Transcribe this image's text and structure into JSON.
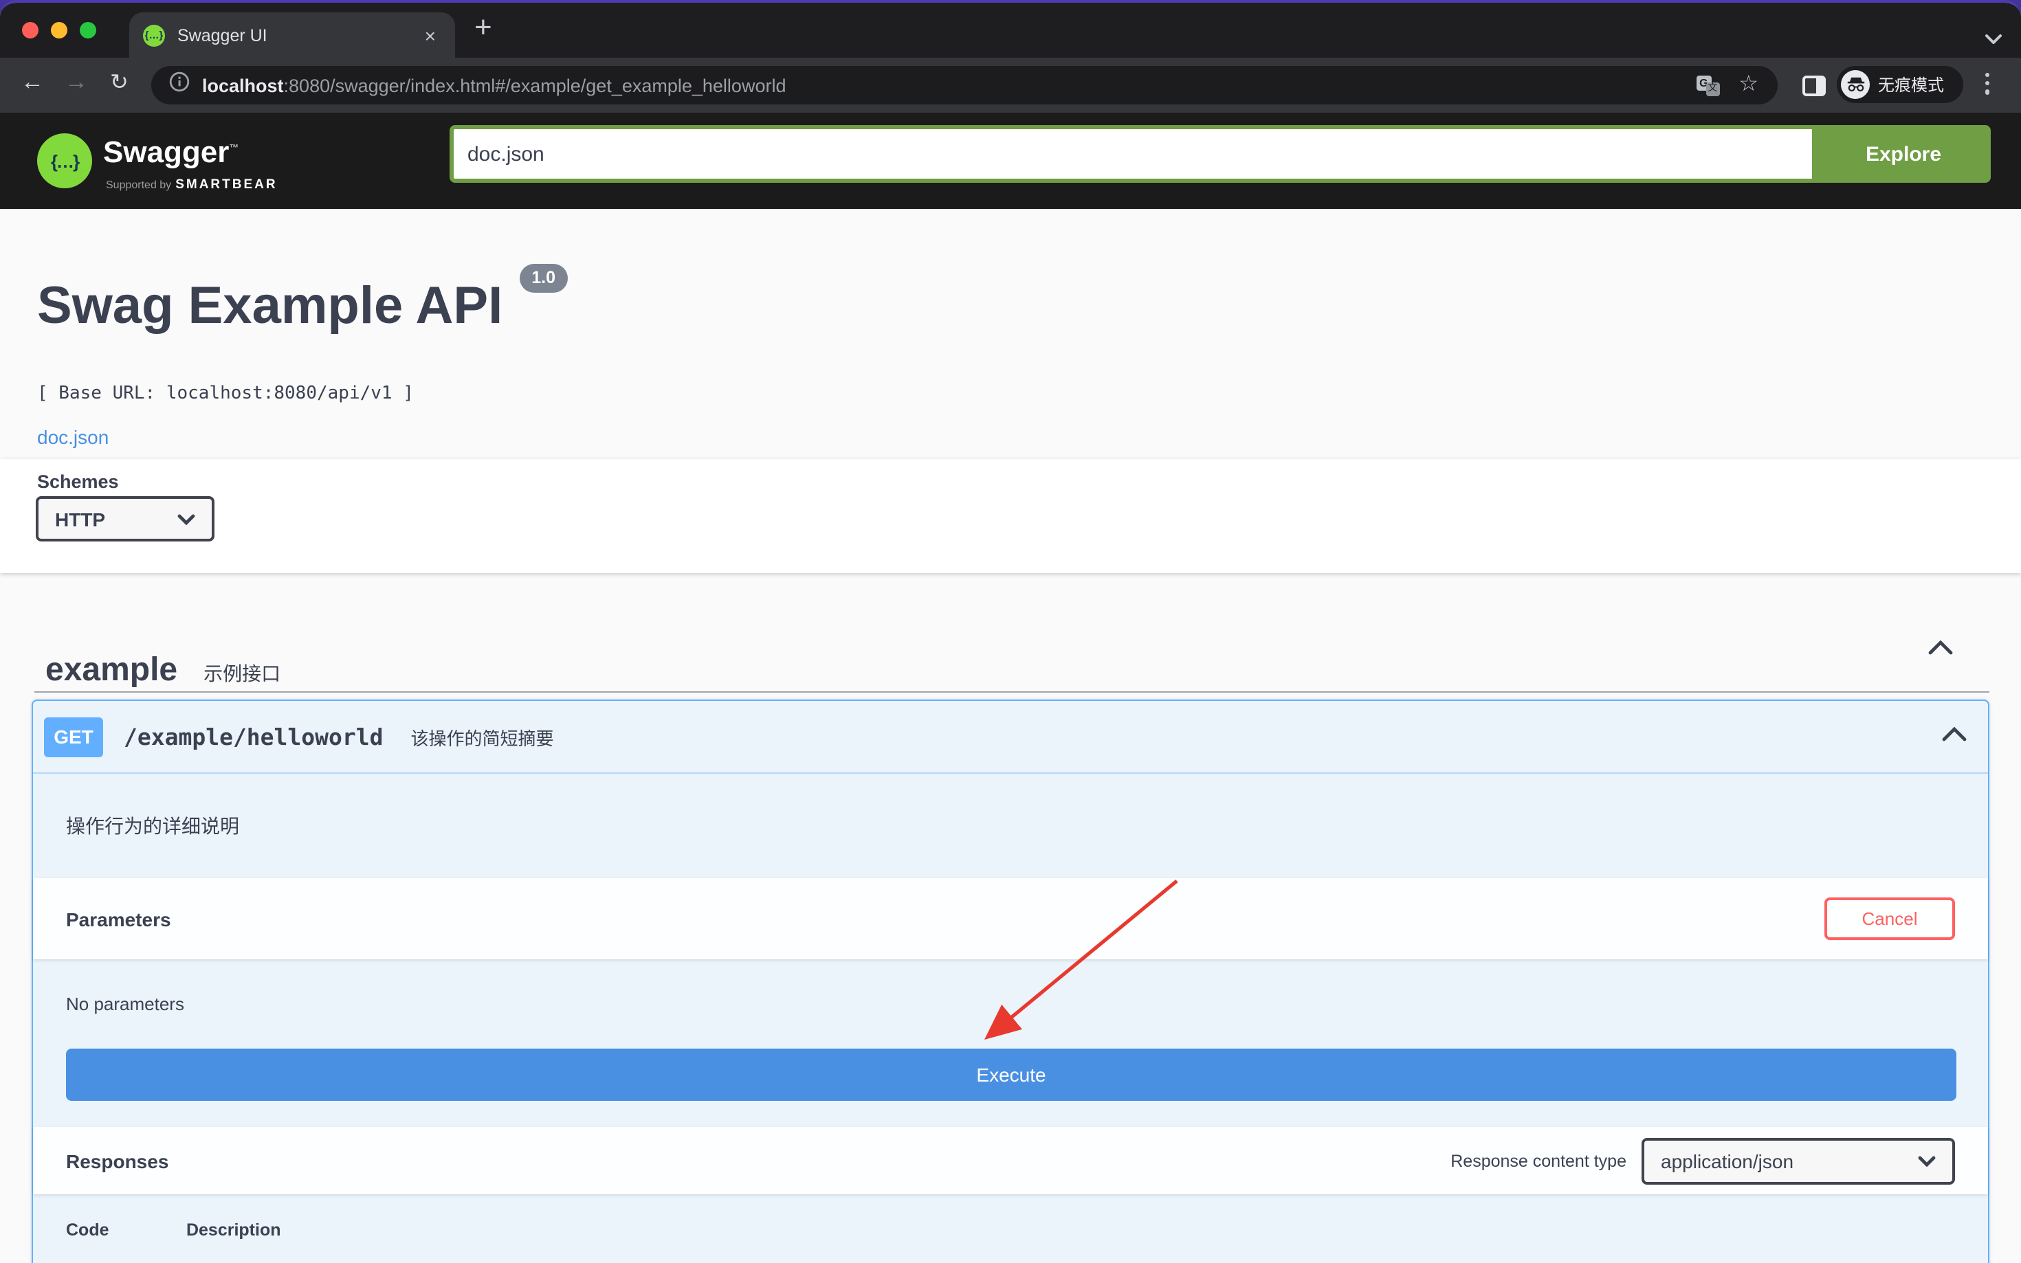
{
  "browser": {
    "tab_title": "Swagger UI",
    "close_glyph": "×",
    "new_tab_glyph": "+",
    "back_glyph": "←",
    "forward_glyph": "→",
    "reload_glyph": "↻",
    "star_glyph": "☆",
    "url_host": "localhost",
    "url_rest": ":8080/swagger/index.html#/example/get_example_helloworld",
    "incognito_label": "无痕模式",
    "translate_g": "G",
    "translate_zh": "文"
  },
  "topbar": {
    "logo_glyph": "{…}",
    "logo_text": "Swagger",
    "logo_tm": "™",
    "supported_by": "Supported by",
    "supported_brand": "SMARTBEAR",
    "search_value": "doc.json",
    "explore_label": "Explore"
  },
  "info": {
    "title": "Swag Example API",
    "version_badge": "1.0",
    "base_url": "[ Base URL: localhost:8080/api/v1 ]",
    "spec_link": "doc.json"
  },
  "schemes": {
    "label": "Schemes",
    "selected": "HTTP"
  },
  "tag": {
    "name": "example",
    "description": "示例接口"
  },
  "operation": {
    "method": "GET",
    "path": "/example/helloworld",
    "summary": "该操作的简短摘要",
    "description": "操作行为的详细说明",
    "parameters_title": "Parameters",
    "cancel_label": "Cancel",
    "no_parameters": "No parameters",
    "execute_label": "Execute",
    "responses_title": "Responses",
    "content_type_label": "Response content type",
    "content_type_value": "application/json",
    "col_code": "Code",
    "col_description": "Description"
  },
  "annotation": {
    "color": "#e8392e"
  },
  "colors": {
    "swagger_green": "#6f9e44",
    "logo_green": "#82d93c",
    "get_blue": "#61affe",
    "execute_blue": "#4990e2",
    "cancel_red": "#ff6060",
    "link_blue": "#4990e2",
    "version_badge_gray": "#7d8492",
    "opblock_bg": "#ebf3fb",
    "topbar_dark": "#1b1b1b"
  }
}
